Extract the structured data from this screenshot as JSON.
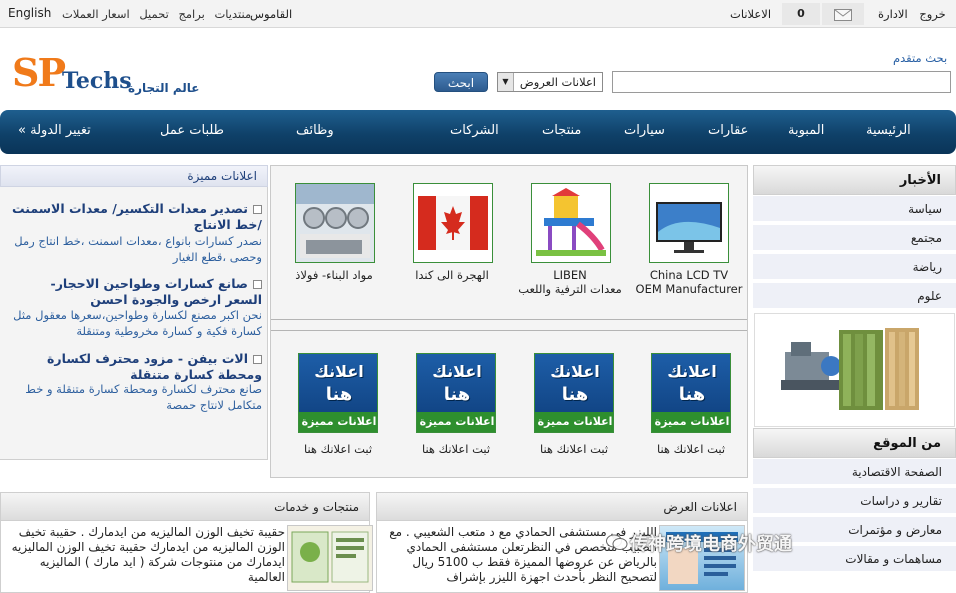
{
  "topbar": {
    "language": "English",
    "links": [
      "منتديات",
      "برامج",
      "تحميل",
      "اسعار العملات"
    ],
    "dictionary": "القاموس",
    "ads": "الاعلانات",
    "count": "0",
    "logout": "خروج",
    "admin": "الادارة"
  },
  "header": {
    "logo_sp": "SP",
    "logo_techs": "Techs",
    "tagline": "عالم التجارة",
    "advanced_search": "بحث متقدم",
    "search_placeholder": "",
    "search_category": "اعلانات العروض",
    "search_button": "ابحث"
  },
  "nav": {
    "home": "الرئيسية",
    "classified": "المبوبة",
    "realestate": "عقارات",
    "cars": "سيارات",
    "products": "منتجات",
    "companies": "الشركات",
    "jobs": "وظائف",
    "job_requests": "طلبات عمل",
    "change_country": "« تغيير الدولة"
  },
  "sidebar": {
    "news_title": "الأخبار",
    "news_items": [
      "سياسة",
      "مجتمع",
      "رياضة",
      "علوم"
    ],
    "site_title": "من الموقع",
    "site_items": [
      "الصفحة الاقتصادية",
      "تقارير و دراسات",
      "معارض و مؤتمرات",
      "مساهمات و مقالات"
    ]
  },
  "featured": {
    "row1": [
      {
        "caption1": "China LCD TV",
        "caption2": "OEM Manufacturer",
        "icon": "tv-image"
      },
      {
        "caption1": "LIBEN",
        "caption2": "معدات الترفية واللعب",
        "icon": "playground-image"
      },
      {
        "caption1": "الهجرة الى كندا",
        "caption2": "",
        "icon": "canada-flag-image"
      },
      {
        "caption1": "مواد البناء- فولاذ",
        "caption2": "",
        "icon": "steel-pipes-image"
      }
    ],
    "ad_placeholder": {
      "line1": "اعلانك",
      "line2": "هنا",
      "band": "اعلانات مميزة",
      "caption": "ثبت اعلانك هنا"
    }
  },
  "left_list": {
    "title": "اعلانات مميزة",
    "items": [
      {
        "title": "تصدير معدات التكسير/ معدات الاسمنت /خط الانتاج",
        "desc": "نصدر كسارات بانواع ،معدات اسمنت ،خط انتاج رمل وحصى ،قطع الغيار"
      },
      {
        "title": "صانع كسارات وطواحين الاحجار- السعر ارخص والجودة احسن",
        "desc": "نحن اكبر مصنع لكسارة وطواحين،سعرها معقول مثل كسارة فكية و كسارة مخروطية ومتنقلة"
      },
      {
        "title": "الات بيفن - مزود محترف لكسارة ومحطة كسارة متنقلة",
        "desc": "صانع محترف لكسارة ومحطة كسارة متنقلة و خط متكامل لانتاج حمصة"
      }
    ]
  },
  "bottom": {
    "offers_title": "اعلانات العرض",
    "offers_text": "الليزر في مستشفى الحمادي مع د متعب الشعيبي . مع الطبيب متخصص في النظرتعلن مستشفى الحمادي بالرياض عن عروضها المميزة فقط ب 5100 ريال لتصحيح النظر بأحدث اجهزة الليزر بإشراف",
    "products_title": "منتجات و خدمات",
    "products_text": "حقيبة تخيف الوزن الماليزيه من ايدمارك . حقيبة تخيف الوزن الماليزيه من ايدمارك حقيبة تخيف الوزن الماليزيه ايدمارك من منتوجات شركة ( ايد مارك ) الماليزيه العالمية"
  },
  "watermark": "传神跨境电商外贸通"
}
